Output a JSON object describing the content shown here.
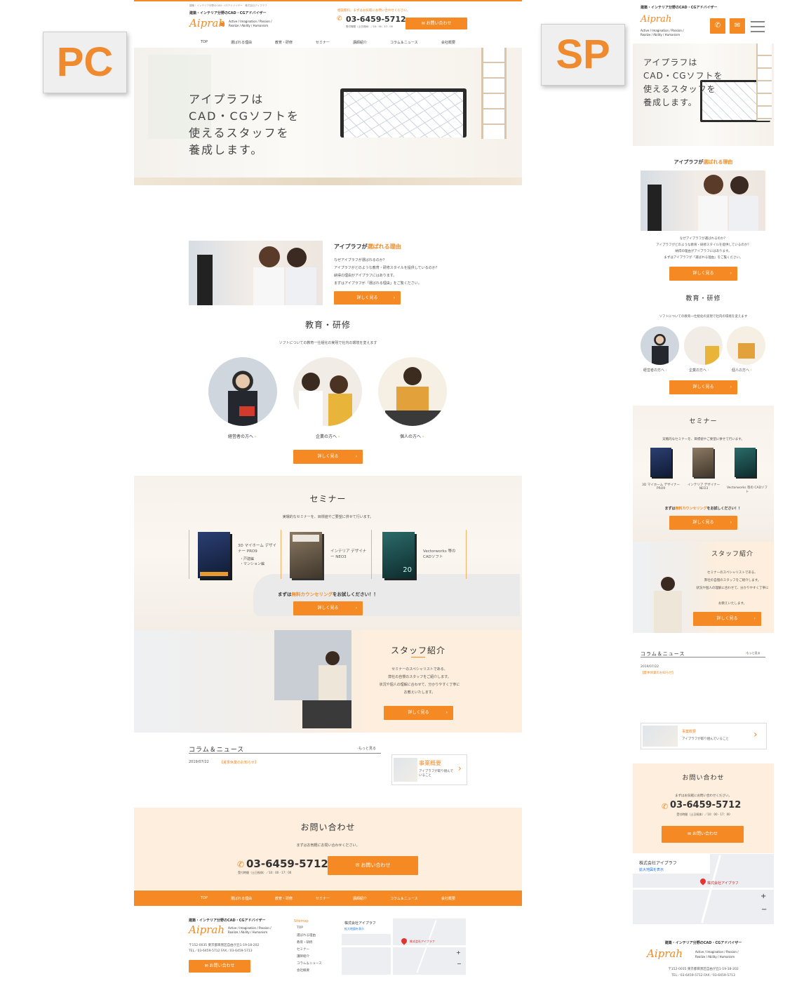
{
  "labels": {
    "pc": "PC",
    "sp": "SP"
  },
  "site": {
    "header_small": "建築・インテリア分野のCAD・CGアドバイザー　株式会社アイプラフ",
    "tagline": "建築・インテリア分野のCAD・CGアドバイザー",
    "logo": "Aiprah",
    "motto": [
      "Active / Imagination / Passion /",
      "Realize / Ability / Humanism"
    ],
    "consult_note": "相談無料。まずはお気軽にお問い合わせください。",
    "phone": "03-6459-5712",
    "hours": "受付時間（土日祝休）／10：00 - 17：00",
    "contact_btn": "お問い合わせ"
  },
  "nav": [
    "TOP",
    "選ばれる理由",
    "教育・研修",
    "セミナー",
    "講師紹介",
    "コラム＆ニュース",
    "会社概要"
  ],
  "hero": {
    "lines": [
      "アイプラフは",
      "CAD・CGソフトを",
      "使えるスタッフを",
      "養成します。"
    ]
  },
  "reason": {
    "title_plain": "アイプラフが",
    "title_accent": "選ばれる理由",
    "lines": [
      "なぜアイプラフが選ばれるのか？",
      "アイプラフがどのような教育・研修スタイルを提供しているのか？",
      "納得の理由がアイプラフにはあります。",
      "まずはアイプラフが「選ばれる理由」をご覧ください。"
    ],
    "btn": "詳しく見る"
  },
  "education": {
    "title": "教育・研修",
    "subtitle": "ソフトについての教育一仕組化の実現で社内の環境を変えます",
    "items": [
      "経営者の方へ",
      "企業の方へ",
      "個人の方へ"
    ],
    "btn": "詳しく見る"
  },
  "seminar": {
    "title": "セミナー",
    "subtitle": "実戦的なセミナーを、目標値やご要望に併せて行います。",
    "items": [
      {
        "name": "3D マイホーム デザイナー PRO9",
        "note": "・戸建編\n・マンション編"
      },
      {
        "name": "インテリア デザイナー NEO3",
        "note": ""
      },
      {
        "name": "Vectorworks 等の CADソフト",
        "note": ""
      }
    ],
    "cta_plain": "まずは",
    "cta_accent": "無料カウンセリング",
    "cta_tail": "をお試しください！！",
    "btn": "詳しく見る"
  },
  "staff": {
    "title": "スタッフ紹介",
    "lines": [
      "セミナーのスペシャリストである、",
      "弊社の自慢のスタッフをご紹介します。",
      "状況や個人の理解に合わせて、分かりやすく丁寧に",
      "お教えいたします。"
    ],
    "btn": "詳しく見る"
  },
  "news": {
    "title": "コラム＆ニュース",
    "more": "もっと見る",
    "date": "2019/07/22",
    "item": "【夏季休業のお知らせ】",
    "banner_title": "事業概要",
    "banner_sub": "アイプラフが取り組んでいること"
  },
  "contact": {
    "title": "お問い合わせ",
    "lead": "まずはお気軽にお問い合わせください。",
    "phone": "03-6459-5712",
    "hours": "受付時間（土日祝休）／10：00 - 17：00",
    "btn": "お問い合わせ"
  },
  "footer": {
    "address": "〒152-0035 東京都目黒区自由が丘1-19-18-202",
    "tel_fax": "TEL／03-6459-5712 FAX／03-6459-5713",
    "sitemap_title": "Sitemap",
    "sitemap": [
      "TOP",
      "選ばれる理由",
      "教育・研修",
      "セミナー",
      "講師紹介",
      "コラム＆ニュース",
      "会社概要"
    ],
    "map_name": "株式会社アイプラフ",
    "map_link": "拡大地図を表示",
    "map_pin": "株式会社アイプラフ",
    "btn": "お問い合わせ"
  },
  "colors": {
    "accent": "#f58a25",
    "cream": "#fdeedd"
  }
}
